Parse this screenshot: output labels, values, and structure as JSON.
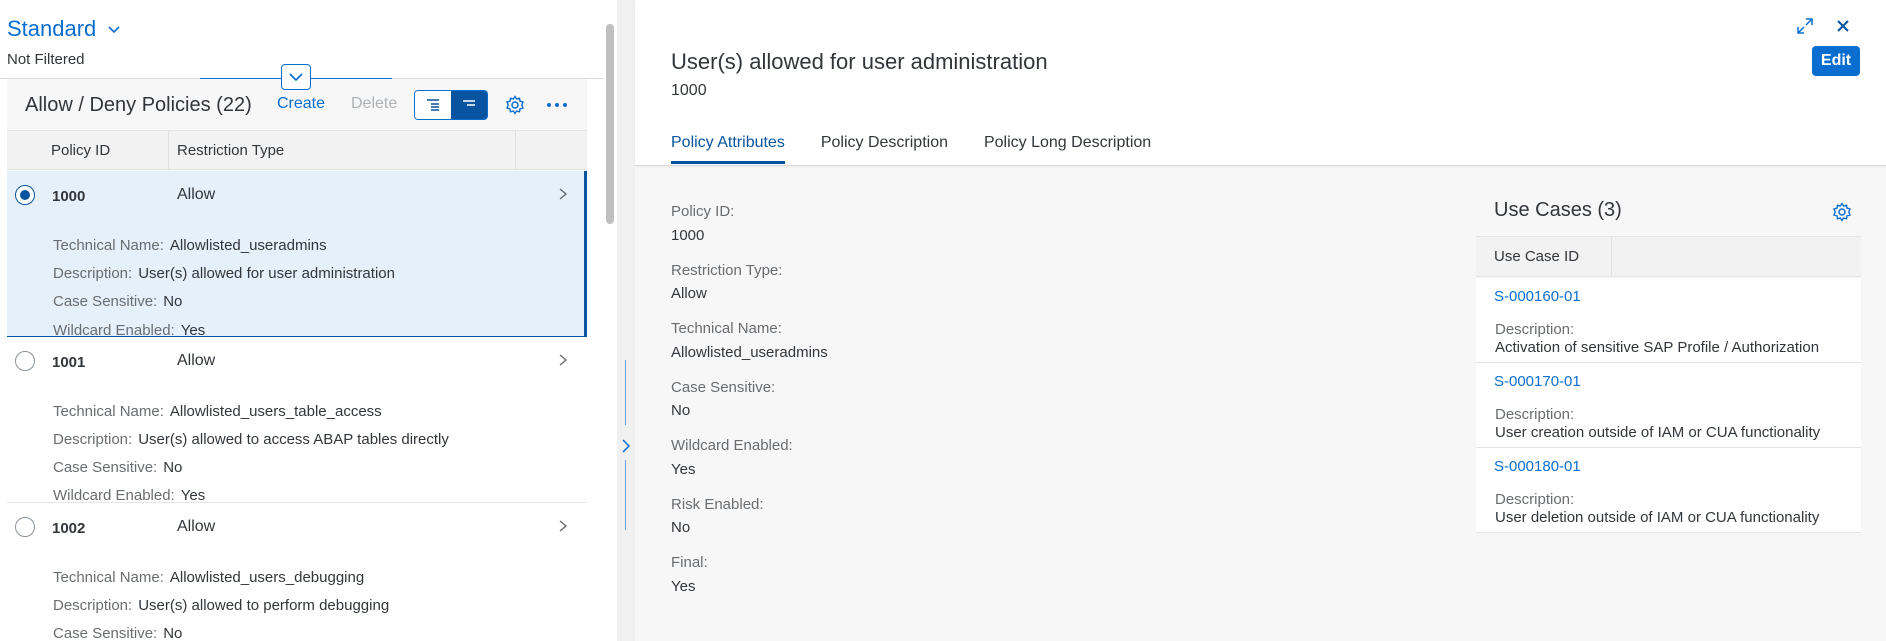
{
  "variant": {
    "title": "Standard",
    "filter_status": "Not Filtered"
  },
  "list": {
    "title": "Allow / Deny Policies (22)",
    "create_label": "Create",
    "delete_label": "Delete",
    "columns": [
      "Policy ID",
      "Restriction Type"
    ],
    "field_labels": {
      "technical_name": "Technical Name:",
      "description": "Description:",
      "case_sensitive": "Case Sensitive:",
      "wildcard_enabled": "Wildcard Enabled:"
    },
    "rows": [
      {
        "id": "1000",
        "type": "Allow",
        "technical_name": "Allowlisted_useradmins",
        "description": "User(s) allowed for user administration",
        "case_sensitive": "No",
        "wildcard_enabled": "Yes",
        "selected": true
      },
      {
        "id": "1001",
        "type": "Allow",
        "technical_name": "Allowlisted_users_table_access",
        "description": "User(s) allowed to access ABAP tables directly",
        "case_sensitive": "No",
        "wildcard_enabled": "Yes",
        "selected": false
      },
      {
        "id": "1002",
        "type": "Allow",
        "technical_name": "Allowlisted_users_debugging",
        "description": "User(s) allowed to perform debugging",
        "case_sensitive": "No",
        "wildcard_enabled": "",
        "selected": false
      }
    ]
  },
  "detail": {
    "title": "User(s) allowed for user administration",
    "subtitle": "1000",
    "edit_label": "Edit",
    "tabs": [
      "Policy Attributes",
      "Policy Description",
      "Policy Long Description"
    ],
    "active_tab": 0,
    "fields": [
      {
        "label": "Policy ID:",
        "value": "1000"
      },
      {
        "label": "Restriction Type:",
        "value": "Allow"
      },
      {
        "label": "Technical Name:",
        "value": "Allowlisted_useradmins"
      },
      {
        "label": "Case Sensitive:",
        "value": "No"
      },
      {
        "label": "Wildcard Enabled:",
        "value": "Yes"
      },
      {
        "label": "Risk Enabled:",
        "value": "No"
      },
      {
        "label": "Final:",
        "value": "Yes"
      }
    ],
    "use_cases": {
      "title": "Use Cases (3)",
      "column": "Use Case ID",
      "desc_label": "Description:",
      "items": [
        {
          "id": "S-000160-01",
          "description": "Activation of sensitive SAP Profile / Authorization"
        },
        {
          "id": "S-000170-01",
          "description": "User creation outside of IAM or CUA functionality"
        },
        {
          "id": "S-000180-01",
          "description": "User deletion outside of IAM or CUA functionality"
        }
      ]
    }
  },
  "icons": {
    "variant_dropdown": "chevron-down-icon",
    "collapse_header": "chevron-down-icon",
    "settings": "gear-icon",
    "more": "overflow-icon",
    "row_nav": "chevron-right-icon",
    "expand": "full-screen-icon",
    "close": "close-icon",
    "splitter": "chevron-right-icon"
  },
  "colors": {
    "accent": "#0a6ed1",
    "accent_dark": "#0854a0",
    "selected_row": "#e5f0fa",
    "background": "#f7f7f7"
  }
}
